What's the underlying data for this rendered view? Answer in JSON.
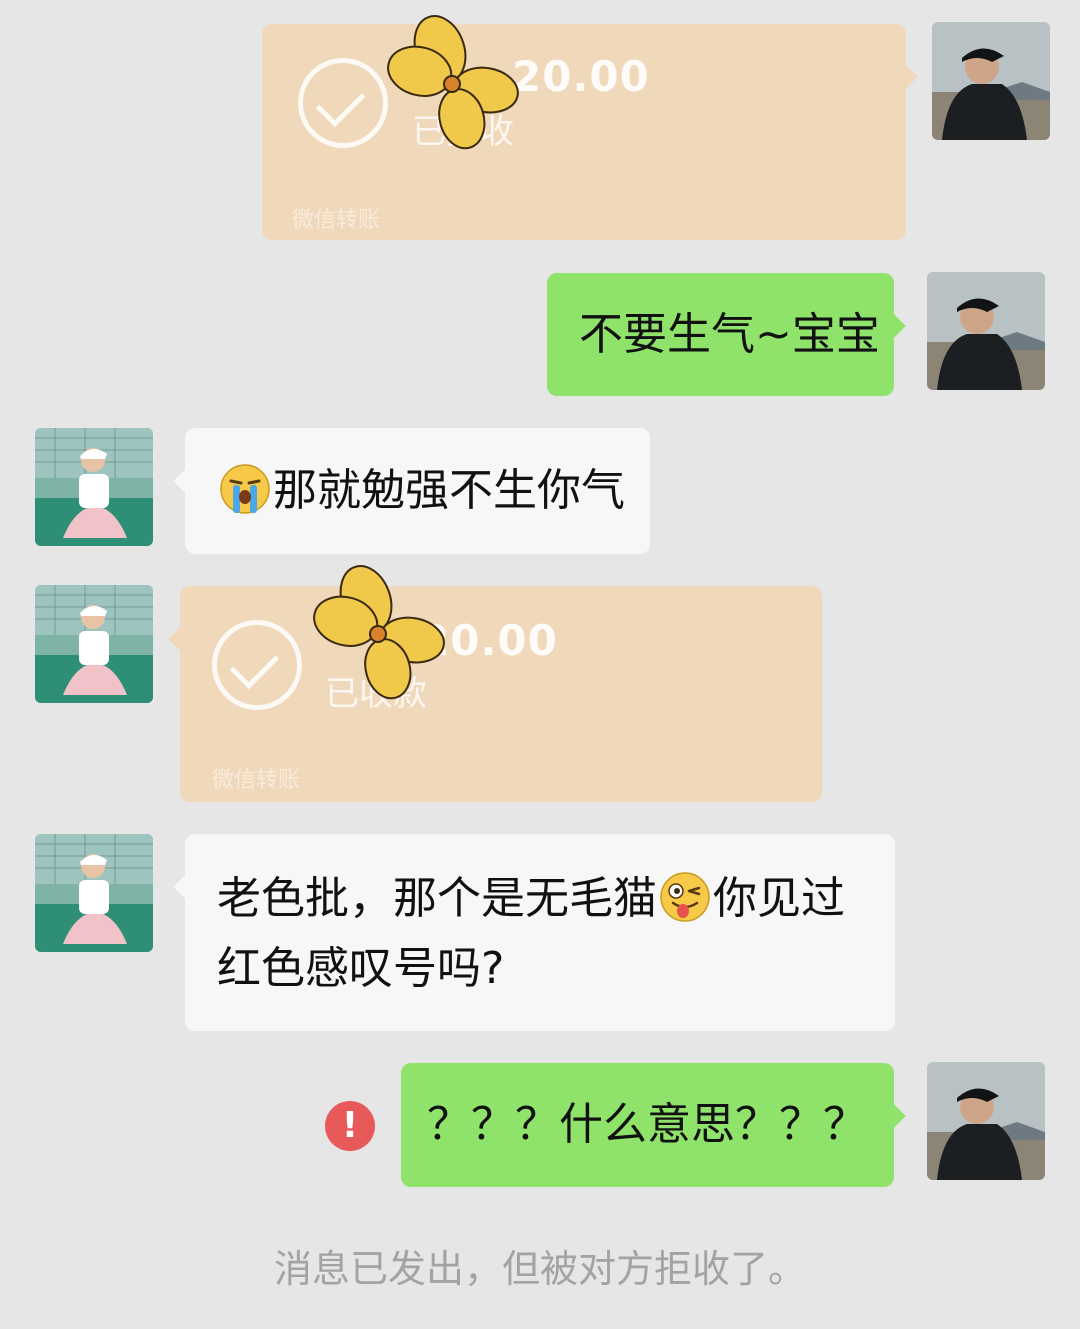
{
  "messages": {
    "transfer_1": {
      "amount": "20.00",
      "status": "已接收",
      "footer": "微信转账"
    },
    "msg_1": {
      "text": "不要生气~宝宝"
    },
    "msg_2": {
      "text": "那就勉强不生你气",
      "emoji": "crying-face-emoji"
    },
    "transfer_2": {
      "amount": "20.00",
      "status": "已收款",
      "footer": "微信转账"
    },
    "msg_3": {
      "line1_a": "老色批，那个是无毛猫",
      "emoji": "winking-tongue-face-emoji",
      "line1_b": "你见过",
      "line2": "红色感叹号吗?"
    },
    "msg_4": {
      "text": "？？？什么意思？？？"
    },
    "error_icon": "!",
    "system_notice": "消息已发出，但被对方拒收了。"
  },
  "colors": {
    "background": "#e6e6e6",
    "sent_bubble": "#8fe26a",
    "received_bubble": "#f7f7f7",
    "transfer_card": "#f0d8ba",
    "error": "#e85a5a",
    "notice_text": "#a3a3a3"
  }
}
